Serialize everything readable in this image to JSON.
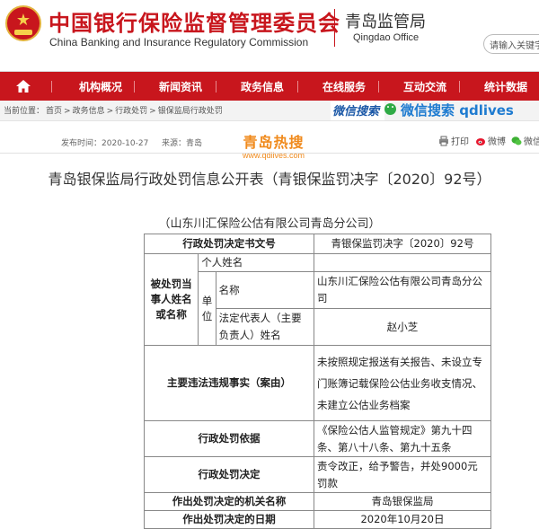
{
  "header": {
    "title_cn": "中国银行保险监督管理委员会",
    "title_en": "China Banking and Insurance Regulatory Commission",
    "office_cn": "青岛监管局",
    "office_en": "Qingdao Office",
    "search_placeholder": "请输入关键字"
  },
  "nav": {
    "home_icon": "home-icon",
    "items": [
      "机构概况",
      "新闻资讯",
      "政务信息",
      "在线服务",
      "互动交流",
      "统计数据"
    ]
  },
  "breadcrumb": {
    "label": "当前位置：",
    "items": [
      "首页",
      "政务信息",
      "行政处罚",
      "银保监局行政处罚"
    ],
    "separator": ">"
  },
  "watermark": {
    "brand": "微信搜索",
    "wechat_search": "微信搜索 qdlives",
    "site_name": "青岛热搜",
    "site_url": "www.qdlives.com"
  },
  "meta": {
    "publish_time_label": "发布时间：",
    "publish_time": "2020-10-27",
    "source_label": "来源：",
    "source": "青岛"
  },
  "share": {
    "print": "打印",
    "weibo": "微博",
    "wechat": "微信"
  },
  "article": {
    "title": "青岛银保监局行政处罚信息公开表（青银保监罚决字〔2020〕92号）",
    "company": "（山东川汇保险公估有限公司青岛分公司）"
  },
  "table": {
    "doc_no_label": "行政处罚决定书文号",
    "doc_no": "青银保监罚决字〔2020〕92号",
    "party_label": "被处罚当事人姓名或名称",
    "personal_label": "个人姓名",
    "personal_value": "",
    "unit_label": "单位",
    "name_label": "名称",
    "name_value": "山东川汇保险公估有限公司青岛分公司",
    "legal_rep_label": "法定代表人（主要负责人）姓名",
    "legal_rep_value": "赵小芝",
    "violation_label": "主要违法违规事实（案由）",
    "violation_value": "未按照规定报送有关报告、未设立专门账簿记载保险公估业务收支情况、未建立公估业务档案",
    "basis_label": "行政处罚依据",
    "basis_value": "《保险公估人监管规定》第九十四条、第八十八条、第九十五条",
    "decision_label": "行政处罚决定",
    "decision_value": "责令改正，给予警告，并处9000元罚款",
    "authority_label": "作出处罚决定的机关名称",
    "authority_value": "青岛银保监局",
    "date_label": "作出处罚决定的日期",
    "date_value": "2020年10月20日"
  }
}
